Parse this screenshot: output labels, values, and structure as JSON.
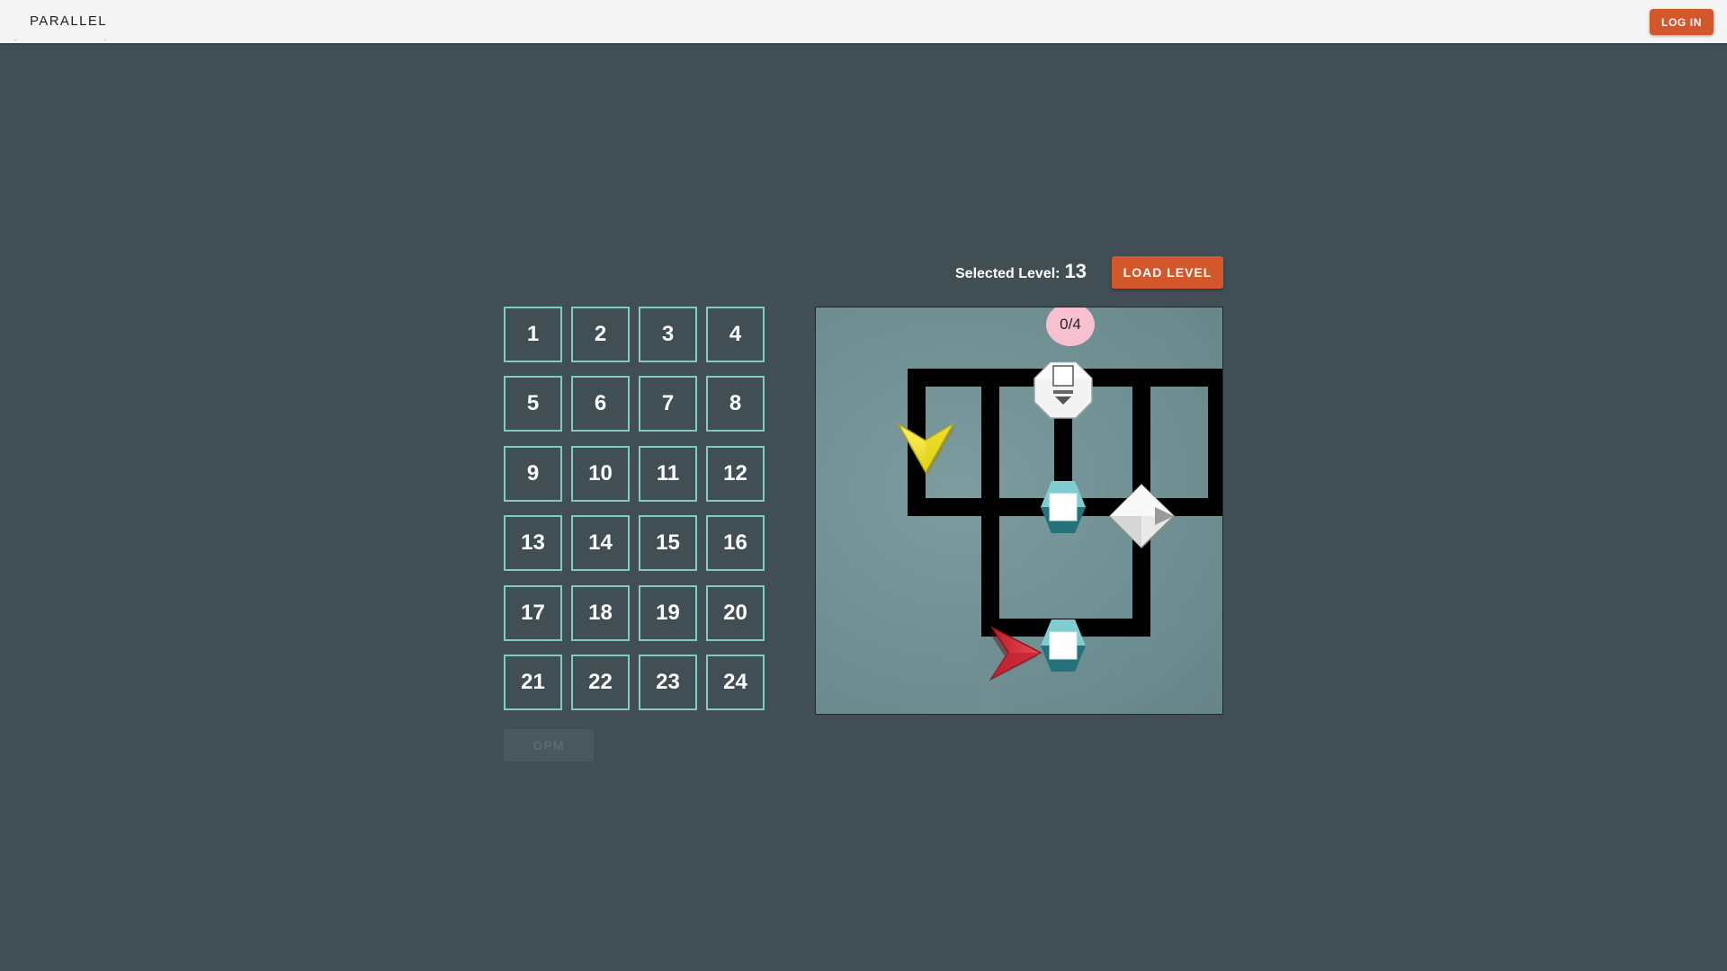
{
  "header": {
    "brand": "PARALLEL",
    "login_label": "LOG IN"
  },
  "levels": [
    "1",
    "2",
    "3",
    "4",
    "5",
    "6",
    "7",
    "8",
    "9",
    "10",
    "11",
    "12",
    "13",
    "14",
    "15",
    "16",
    "17",
    "18",
    "19",
    "20",
    "21",
    "22",
    "23",
    "24"
  ],
  "opm_label": "OPM",
  "selection": {
    "label": "Selected Level:",
    "value": "13",
    "load_label": "LOAD LEVEL"
  },
  "board": {
    "counter": "0/4",
    "pieces": [
      {
        "name": "yellow-arrow-icon",
        "type": "arrow",
        "color": "#f0e22b",
        "direction": "down"
      },
      {
        "name": "red-arrow-icon",
        "type": "arrow",
        "color": "#d8323c",
        "direction": "right"
      },
      {
        "name": "delivery-point-icon",
        "type": "octagon",
        "color": "#f2f2f2"
      },
      {
        "name": "package-pickup-icon-1",
        "type": "hexagon",
        "color": "#3a9a9f"
      },
      {
        "name": "package-pickup-icon-2",
        "type": "hexagon",
        "color": "#3a9a9f"
      },
      {
        "name": "switch-diamond-icon",
        "type": "diamond",
        "color": "#eeeeee"
      }
    ]
  },
  "colors": {
    "background": "#414f55",
    "accent": "#d2572a",
    "tile_border": "#80cbc4",
    "board_bg": "#6f8f93",
    "track": "#000000"
  }
}
